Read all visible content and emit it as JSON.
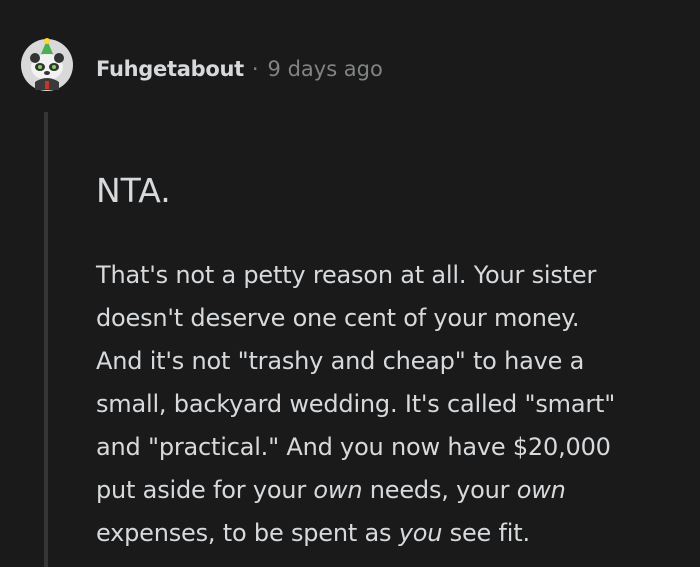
{
  "comment": {
    "author": "Fuhgetabout",
    "separator": "·",
    "time": "9 days ago",
    "avatar_icon": "panda-avatar-with-party-hat",
    "heading": "NTA.",
    "body": {
      "lines": [
        "That's not a petty reason at all. Your sister",
        "doesn't deserve one cent of your money.",
        "And it's not \"trashy and cheap\" to have a",
        "small, backyard wedding. It's called \"smart\"",
        "and \"practical.\" And you now have $20,000"
      ],
      "line6_a": "put aside for your ",
      "line6_em": "own",
      "line6_b": " needs, your ",
      "line6_em2": "own",
      "line7_a": "expenses, to be spent as ",
      "line7_em": "you",
      "line7_b": " see fit."
    }
  },
  "colors": {
    "background": "#1a1a1b",
    "text": "#d7dadc",
    "meta": "#818384",
    "thread_line": "#343536"
  }
}
